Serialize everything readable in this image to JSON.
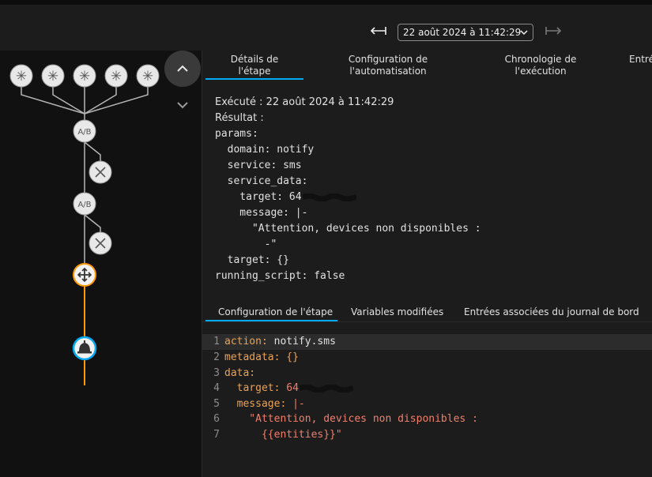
{
  "header": {
    "timestamp_select": "22 août 2024 à 11:42:29",
    "prev_icon": "arrow-left-bar-icon",
    "next_icon": "arrow-right-bar-icon"
  },
  "graph": {
    "trigger_icons": [
      "asterisk-icon",
      "asterisk-icon",
      "asterisk-icon",
      "asterisk-icon",
      "asterisk-icon"
    ],
    "condition_label": "A/B",
    "accent_orange": "#ff9800",
    "accent_blue": "#03a9f4"
  },
  "tabs": [
    {
      "label": "Détails de\nl'étape"
    },
    {
      "label": "Configuration de\nl'automatisation"
    },
    {
      "label": "Chronologie de\nl'exécution"
    },
    {
      "label": "Entré"
    }
  ],
  "trace": {
    "executed_label": "Exécuté : 22 août 2024 à 11:42:29",
    "result_label": "Résultat :",
    "lines": [
      "params:",
      "  domain: notify",
      "  service: sms",
      "  service_data:",
      "    target: 64",
      "    message: |-",
      "      \"Attention, devices non disponibles :",
      "        -\"",
      "  target: {}",
      "running_script: false"
    ]
  },
  "subtabs": [
    {
      "label": "Configuration de l'étape"
    },
    {
      "label": "Variables modifiées"
    },
    {
      "label": "Entrées associées du journal de bord"
    }
  ],
  "code": {
    "line_numbers": [
      "1",
      "2",
      "3",
      "4",
      "5",
      "6",
      "7"
    ],
    "l1_key": "action:",
    "l1_val": " notify.sms",
    "l2_key": "metadata:",
    "l2_val": " {}",
    "l3_key": "data:",
    "l4_key": "  target:",
    "l4_val": " 64",
    "l5_key": "  message:",
    "l5_val": " |-",
    "l6_val": "    \"Attention, devices non disponibles :",
    "l7_val": "      {{entities}}\""
  }
}
